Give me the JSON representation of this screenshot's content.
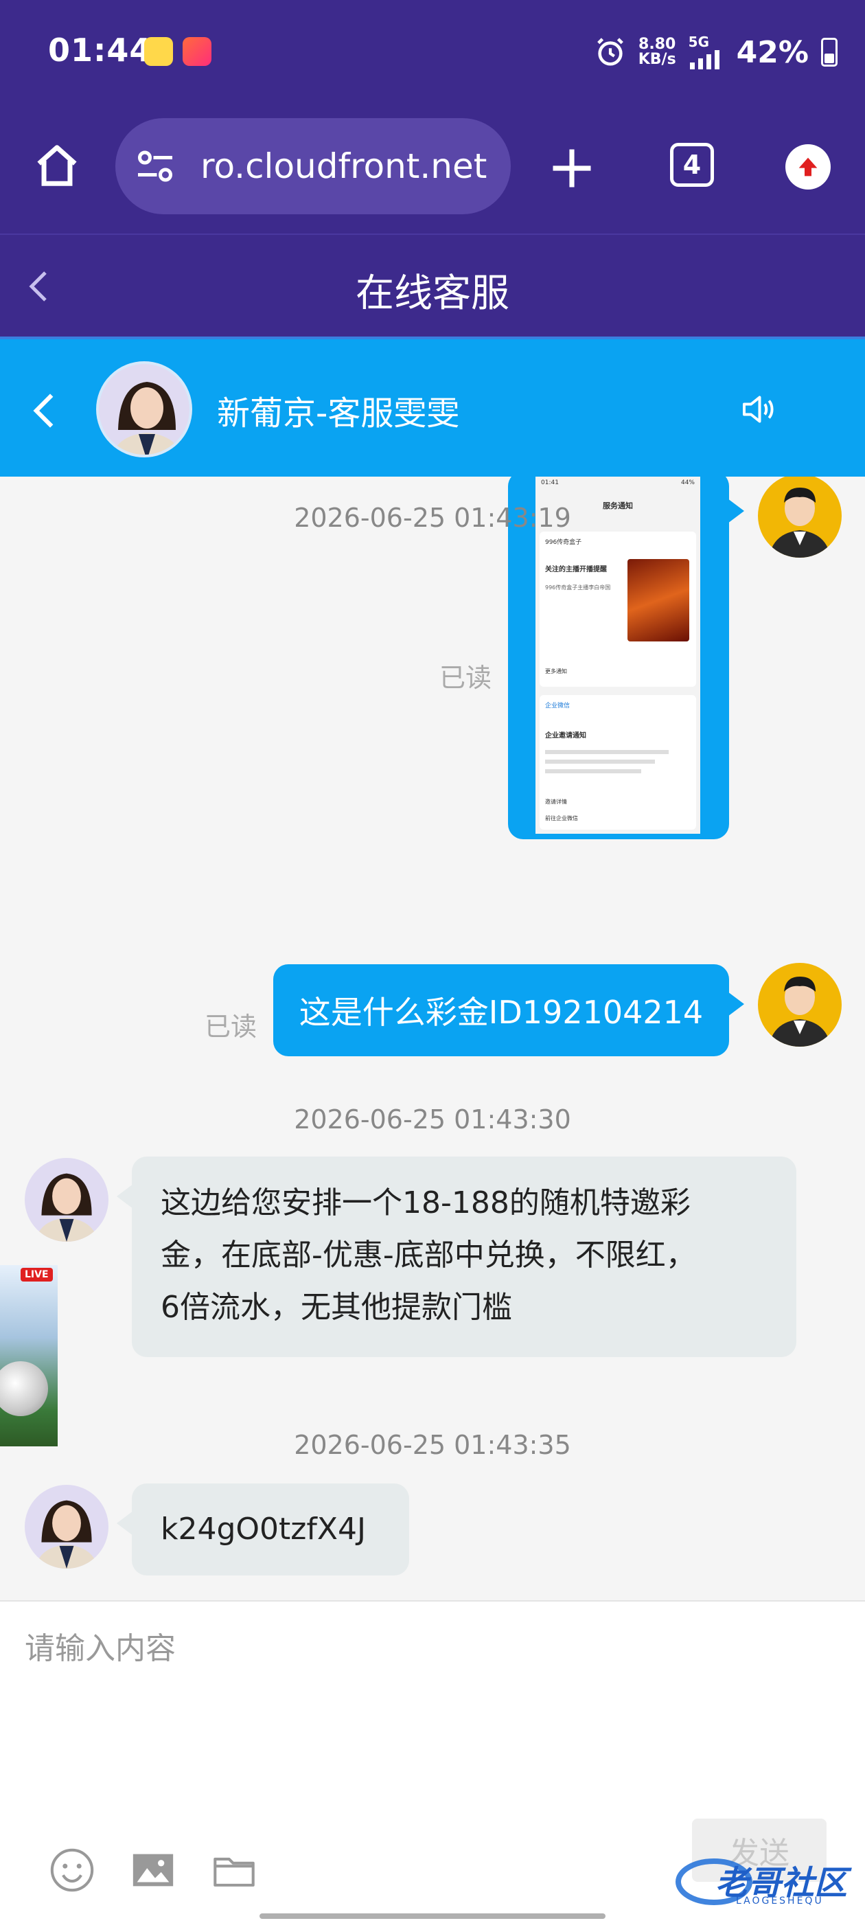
{
  "status_bar": {
    "time": "01:44",
    "net_speed_value": "8.80",
    "net_speed_unit": "KB/s",
    "network": "5G",
    "battery": "42%"
  },
  "browser": {
    "url": "ro.cloudfront.net",
    "tab_count": "4"
  },
  "page": {
    "title": "在线客服"
  },
  "chat": {
    "agent_name": "新葡京-客服雯雯",
    "messages": [
      {
        "type": "image",
        "sender": "user",
        "read_status": "已读"
      },
      {
        "type": "timestamp",
        "text": "2026-06-25 01:43:19"
      },
      {
        "type": "text",
        "sender": "user",
        "text": "这是什么彩金ID192104214",
        "read_status": "已读"
      },
      {
        "type": "timestamp",
        "text": "2026-06-25 01:43:30"
      },
      {
        "type": "text",
        "sender": "agent",
        "lines": [
          "这边给您安排一个18-188的随机特邀彩",
          "金，在底部-优惠-底部中兑换，不限红，",
          "6倍流水，无其他提款门槛"
        ]
      },
      {
        "type": "timestamp",
        "text": "2026-06-25 01:43:35"
      },
      {
        "type": "text",
        "sender": "agent",
        "text": "k24gO0tzfX4J"
      }
    ]
  },
  "shot": {
    "time": "01:41",
    "title": "服务通知",
    "card1_name": "996传奇盒子",
    "card1_title": "关注的主播开播提醒",
    "card1_desc": "996传奇盒子主播李白帝国",
    "card1_more": "更多通知",
    "card2_name": "企业微信",
    "card2_title": "企业邀请通知",
    "card2_detail": "邀请详情",
    "card2_join": "前往企业微信"
  },
  "input": {
    "placeholder": "请输入内容",
    "send_label": "发送"
  },
  "float_ad": {
    "label": "LIVE"
  },
  "watermark": {
    "text": "老哥社区",
    "sub": "LAOGESHEQU"
  },
  "colors": {
    "header_purple": "#3d2a8c",
    "chat_blue": "#0aa3f2",
    "incoming_bubble": "#e6ebec"
  }
}
